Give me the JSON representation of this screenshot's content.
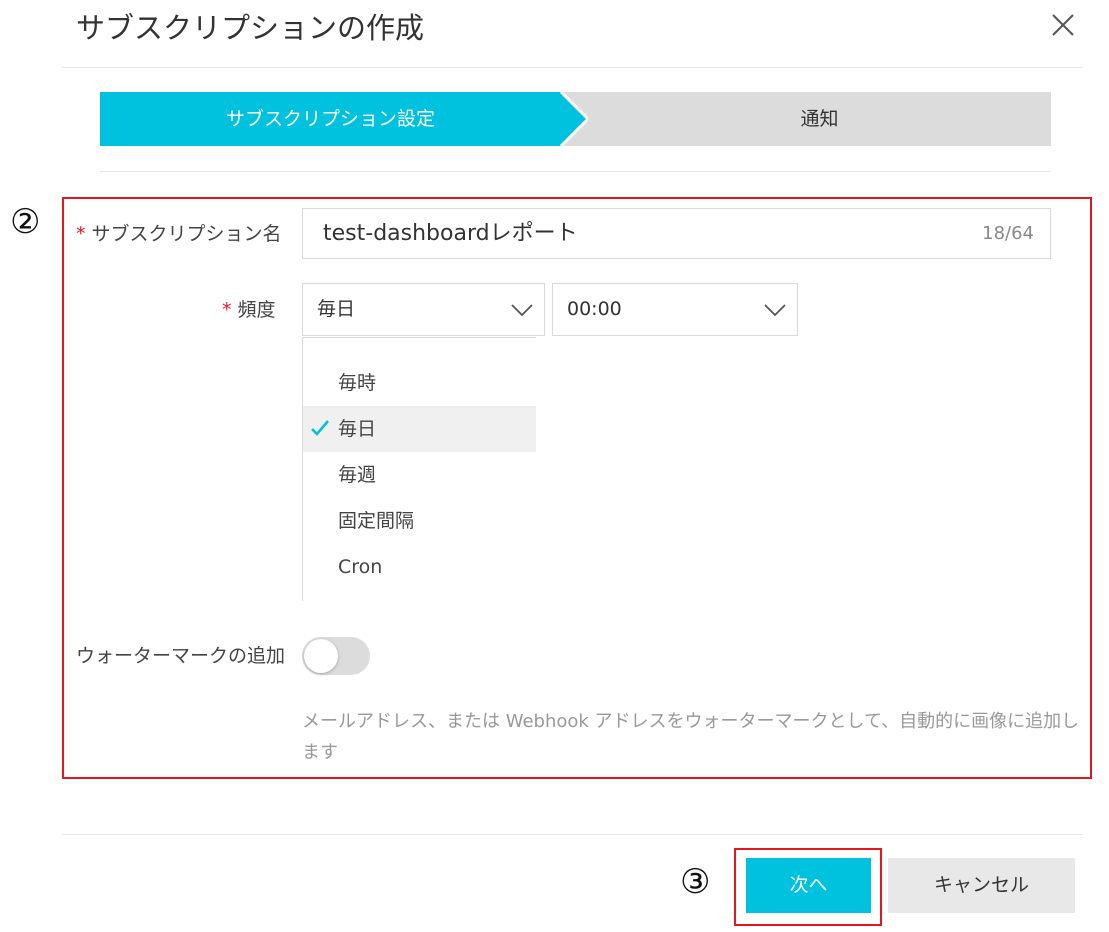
{
  "dialog": {
    "title": "サブスクリプションの作成"
  },
  "steps": [
    {
      "label": "サブスクリプション設定",
      "active": true
    },
    {
      "label": "通知",
      "active": false
    }
  ],
  "annotations": {
    "form_marker": "②",
    "button_marker": "③"
  },
  "form": {
    "name": {
      "label": "サブスクリプション名",
      "value": "test-dashboardレポート",
      "counter": "18/64"
    },
    "frequency": {
      "label": "頻度",
      "selected": "毎日",
      "time": "00:00",
      "options": [
        "毎時",
        "毎日",
        "毎週",
        "固定間隔",
        "Cron"
      ]
    },
    "watermark": {
      "label": "ウォーターマークの追加",
      "enabled": false,
      "hint": "メールアドレス、または Webhook アドレスをウォーターマークとして、自動的に画像に追加します"
    }
  },
  "footer": {
    "next_label": "次へ",
    "cancel_label": "キャンセル"
  },
  "colors": {
    "accent": "#00c1de",
    "step_inactive": "#dcdcdc",
    "required": "#e6161f",
    "annotation_border": "#e6161f"
  },
  "icons": {
    "close": "close-icon",
    "dropdown": "chevron-down-icon",
    "check": "check-icon"
  }
}
